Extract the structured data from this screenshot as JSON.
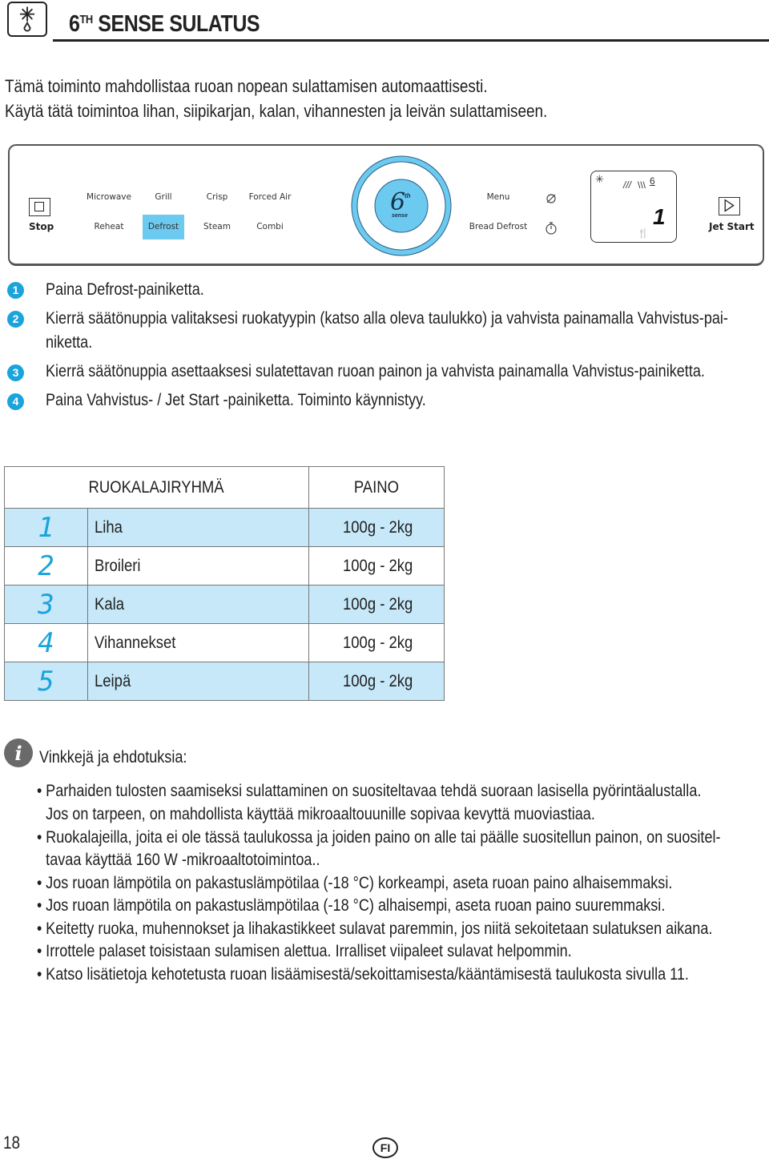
{
  "header": {
    "icon": "defrost-icon",
    "title_prefix": "6",
    "title_sup": "TH",
    "title_rest": " SENSE SULATUS"
  },
  "intro": [
    "Tämä toiminto mahdollistaa ruoan nopean sulattamisen automaattisesti.",
    "Käytä tätä toimintoa lihan, siipikarjan, kalan, vihannesten ja leivän sulattamiseen."
  ],
  "panel": {
    "stop_label": "Stop",
    "top_row": [
      "Microwave",
      "Grill",
      "Crisp",
      "Forced Air"
    ],
    "bottom_row": [
      "Reheat",
      "Defrost",
      "Steam",
      "Combi"
    ],
    "selected": "Defrost",
    "knob_text": "6",
    "knob_sup": "th",
    "knob_sub": "sense",
    "menu_label": "Menu",
    "bread_defrost_label": "Bread Defrost",
    "display_digit": "1",
    "jet_start_label": "Jet Start",
    "accent_color": "#6ccaf0"
  },
  "steps": [
    {
      "num": "1",
      "text": "Paina Defrost-painiketta."
    },
    {
      "num": "2",
      "text": "Kierrä säätönuppia valitaksesi ruokatyypin (katso alla oleva taulukko) ja vahvista painamalla Vahvistus-pai-",
      "text2": "niketta."
    },
    {
      "num": "3",
      "text": "Kierrä säätönuppia  asettaaksesi sulatettavan ruoan painon ja vahvista painamalla Vahvistus-painiketta."
    },
    {
      "num": "4",
      "text": "Paina Vahvistus- / Jet Start -painiketta. Toiminto käynnistyy."
    }
  ],
  "table": {
    "headers": [
      "RUOKALAJIRYHMÄ",
      "PAINO"
    ],
    "rows": [
      {
        "code": "1",
        "food": "Liha",
        "weight": "100g - 2kg"
      },
      {
        "code": "2",
        "food": "Broileri",
        "weight": "100g - 2kg"
      },
      {
        "code": "3",
        "food": "Kala",
        "weight": "100g - 2kg"
      },
      {
        "code": "4",
        "food": "Vihannekset",
        "weight": "100g - 2kg"
      },
      {
        "code": "5",
        "food": "Leipä",
        "weight": "100g - 2kg"
      }
    ]
  },
  "tips": {
    "title": "Vinkkejä ja ehdotuksia:",
    "lines": [
      {
        "bullet": "•",
        "text": "Parhaiden tulosten saamiseksi sulattaminen on suositeltavaa tehdä suoraan lasisella pyörintäalustalla."
      },
      {
        "bullet": "",
        "text": "Jos on tarpeen, on mahdollista käyttää mikroaaltouunille sopivaa kevyttä muoviastiaa."
      },
      {
        "bullet": "•",
        "text": "Ruokalajeilla, joita ei ole tässä taulukossa ja joiden paino on alle tai päälle suositellun painon, on suositel-"
      },
      {
        "bullet": "",
        "text": "tavaa käyttää  160 W -mikroaaltotoimintoa.."
      },
      {
        "bullet": "•",
        "text": "Jos ruoan lämpötila on pakastuslämpötilaa (-18 °C) korkeampi, aseta ruoan paino alhaisemmaksi."
      },
      {
        "bullet": "•",
        "text": "Jos ruoan lämpötila on pakastuslämpötilaa (-18 °C) alhaisempi, aseta ruoan paino suuremmaksi."
      },
      {
        "bullet": "•",
        "text": "Keitetty ruoka, muhennokset ja lihakastikkeet sulavat paremmin, jos niitä sekoitetaan sulatuksen aikana."
      },
      {
        "bullet": "•",
        "text": "Irrottele palaset toisistaan sulamisen alettua. Irralliset viipaleet sulavat helpommin."
      },
      {
        "bullet": "•",
        "text": "Katso lisätietoja kehotetusta ruoan lisäämisestä/sekoittamisesta/kääntämisestä taulukosta sivulla 11."
      }
    ]
  },
  "footer": {
    "page_number": "18",
    "language": "FI"
  }
}
